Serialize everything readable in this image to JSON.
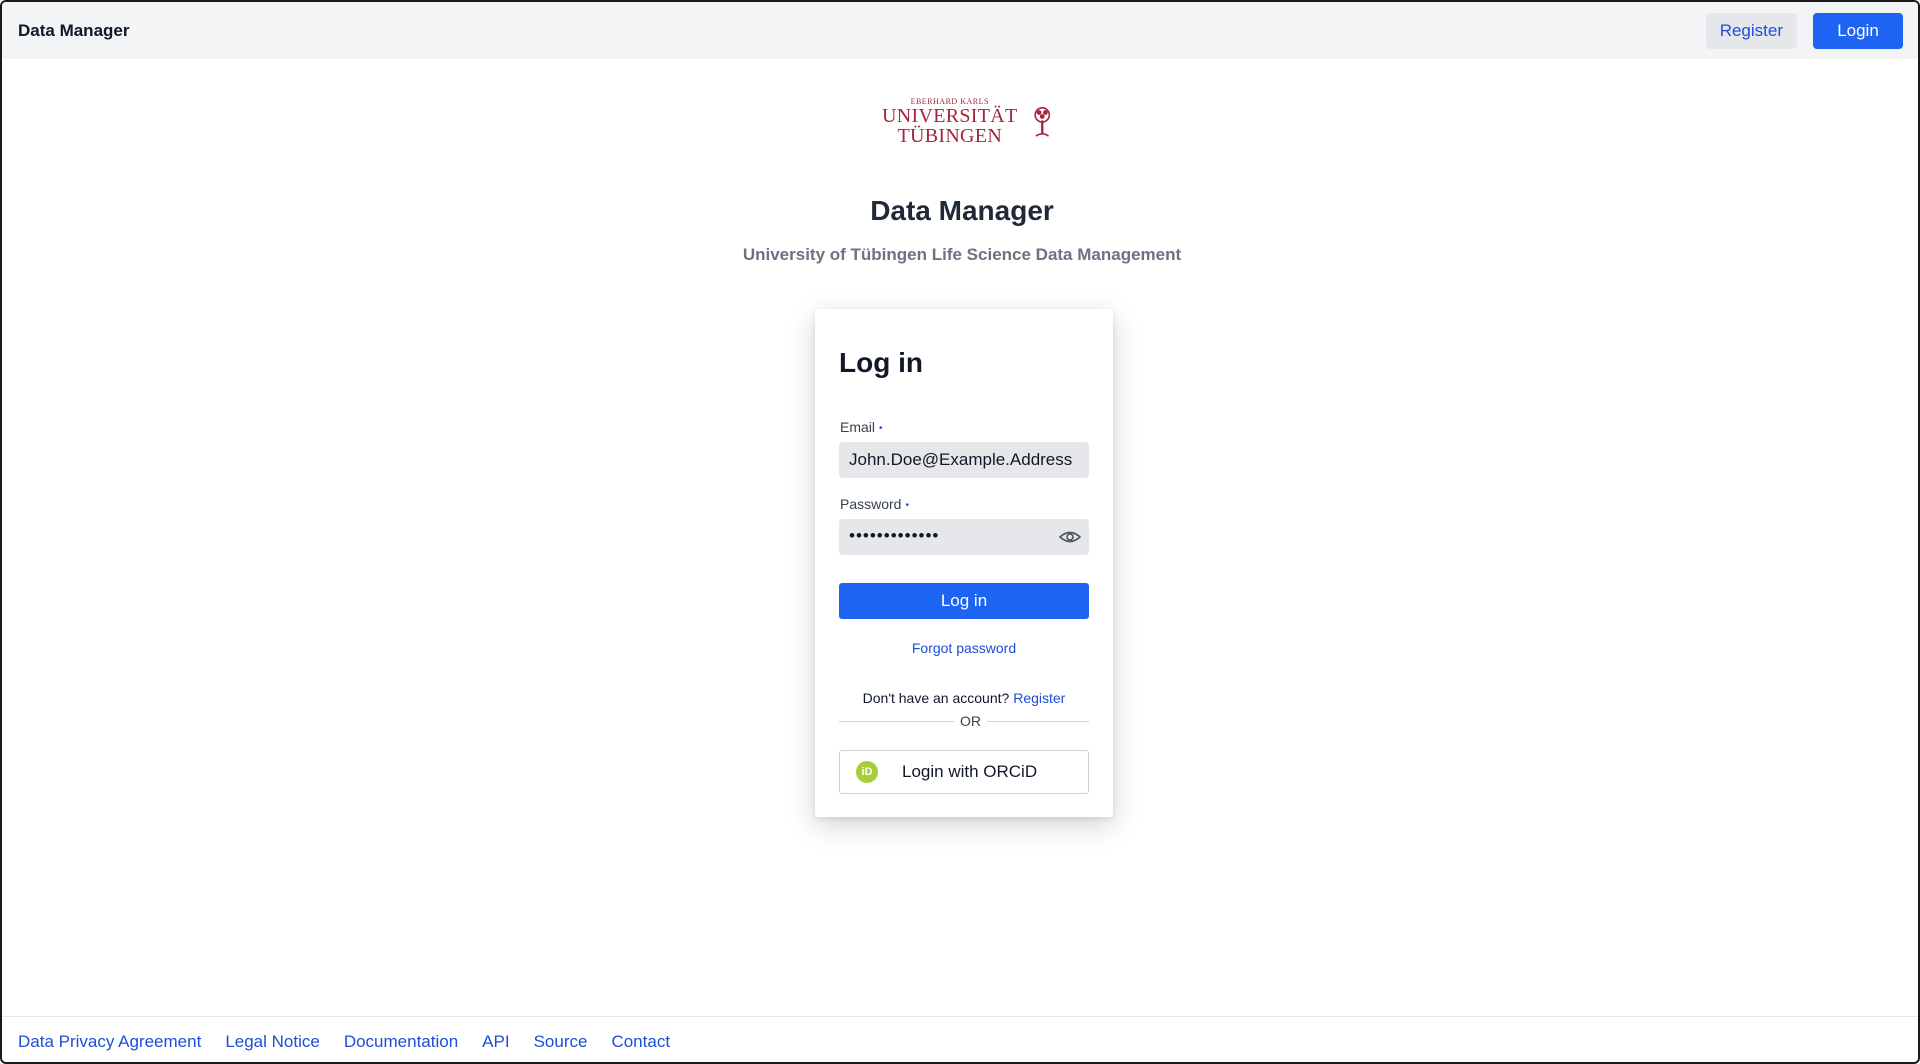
{
  "navbar": {
    "brand": "Data Manager",
    "register_label": "Register",
    "login_label": "Login"
  },
  "logo": {
    "small_text": "EBERHARD KARLS",
    "line1": "UNIVERSITÄT",
    "line2": "TÜBINGEN",
    "icon": "tree-seal-icon"
  },
  "header": {
    "title": "Data Manager",
    "subtitle": "University of Tübingen Life Science Data Management"
  },
  "login_card": {
    "title": "Log in",
    "email_label": "Email",
    "email_value": "John.Doe@Example.Address",
    "password_label": "Password",
    "password_value": "•••••••••••••",
    "required_marker": "•",
    "submit_label": "Log in",
    "forgot_label": "Forgot password",
    "no_account_text": "Don't have an account?",
    "register_link": "Register",
    "or_text": "OR",
    "orcid_icon_text": "iD",
    "orcid_label": "Login with ORCiD"
  },
  "footer": {
    "links": [
      "Data Privacy Agreement",
      "Legal Notice",
      "Documentation",
      "API",
      "Source",
      "Contact"
    ]
  },
  "colors": {
    "primary": "#1d64f2",
    "link": "#1d4ed8",
    "logo_red": "#a5243a",
    "orcid_green": "#a6ce39"
  }
}
